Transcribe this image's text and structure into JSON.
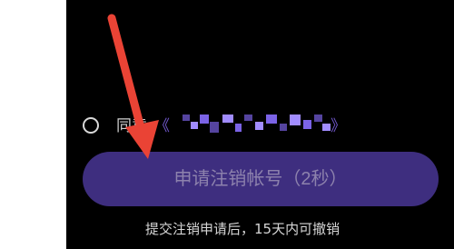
{
  "consent": {
    "prefix": "同意",
    "agreement_open": "《",
    "agreement_close": "》"
  },
  "actions": {
    "submit_label": "申请注销帐号（2秒）"
  },
  "notice": {
    "text": "提交注销申请后，15天内可撤销"
  },
  "colors": {
    "accent": "#6f56c8",
    "button": "#3e2e7f",
    "button_text": "#8d82ad",
    "annotation_arrow": "#ea4335"
  },
  "icons": {
    "radio": "radio-unchecked-icon",
    "annotation": "red-arrow-icon"
  }
}
